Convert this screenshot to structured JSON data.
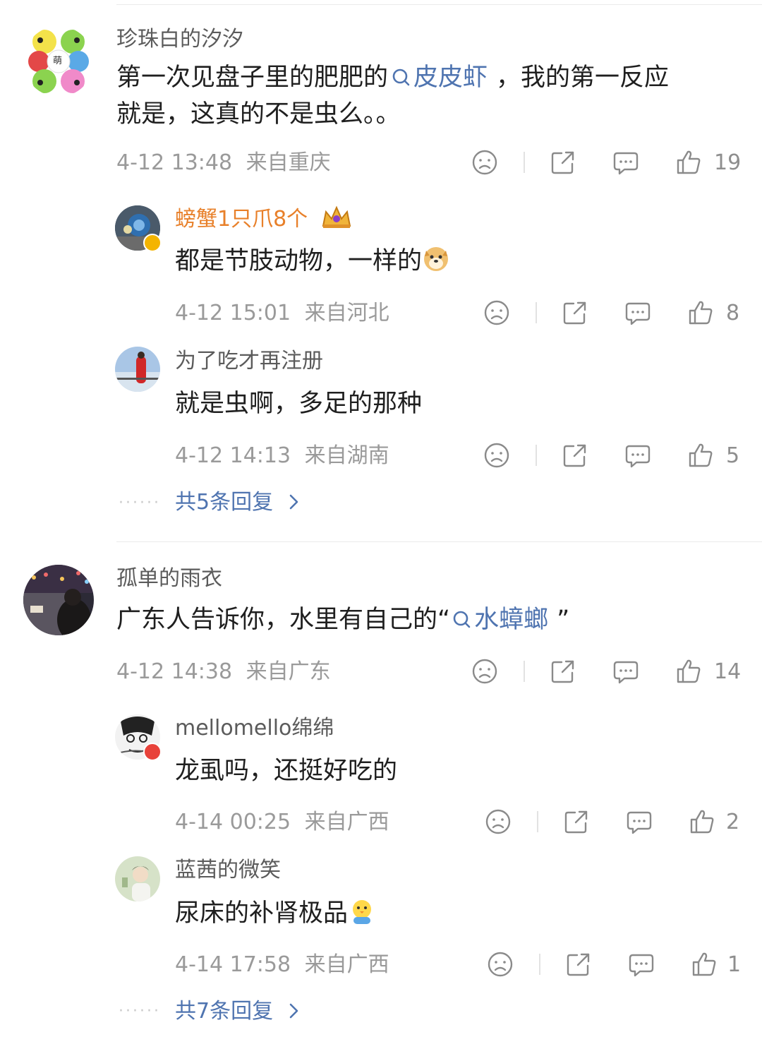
{
  "comments": [
    {
      "author": "珍珠白的汐汐",
      "text_before": "第一次见盘子里的肥肥的",
      "topic": "皮皮虾",
      "text_after": "，我的第一反应",
      "text_line2": "就是，这真的不是虫么。。",
      "time": "4-12 13:48",
      "location": "来自重庆",
      "likes": "19",
      "avatar_text": "萌",
      "replies": [
        {
          "author": "螃蟹1只爪8个",
          "text": "都是节肢动物，一样的",
          "time": "4-12 15:01",
          "location": "来自河北",
          "likes": "8"
        },
        {
          "author": "为了吃才再注册",
          "text": "就是虫啊，多足的那种",
          "time": "4-12 14:13",
          "location": "来自湖南",
          "likes": "5"
        }
      ],
      "more_replies": "共5条回复"
    },
    {
      "author": "孤单的雨衣",
      "text_before": "广东人告诉你，水里有自己的“",
      "topic": "水蟑螂",
      "text_after": "”",
      "time": "4-12 14:38",
      "location": "来自广东",
      "likes": "14",
      "replies": [
        {
          "author": "mellomello绵绵",
          "text": "龙虱吗，还挺好吃的",
          "time": "4-14 00:25",
          "location": "来自广西",
          "likes": "2"
        },
        {
          "author": "蓝茜的微笑",
          "text": "尿床的补肾极品",
          "time": "4-14 17:58",
          "location": "来自广西",
          "likes": "1"
        }
      ],
      "more_replies": "共7条回复"
    }
  ],
  "icons": {
    "dislike": "sad-face-icon",
    "share": "share-icon",
    "comment": "comment-icon",
    "like": "thumbs-up-icon",
    "topic": "search-icon"
  },
  "colors": {
    "link": "#4f74b0",
    "gold_name": "#e8802a",
    "meta": "#9a9a9a"
  }
}
